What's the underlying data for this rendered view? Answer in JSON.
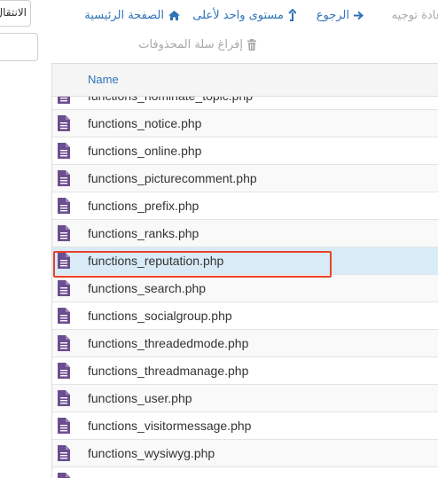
{
  "left_panel": {
    "button_label": "الانتقال",
    "input_value": ""
  },
  "toolbar": {
    "redirect_label": "إعادة توجيه",
    "back_label": "الرجوع",
    "up_label": "مستوى واحد لأعلى",
    "home_label": "الصفحة الرئيسية",
    "empty_trash_label": "إفراغ سلة المحذوفات"
  },
  "table": {
    "header": "Name",
    "rows": [
      "functions_nominate_topic.php",
      "functions_notice.php",
      "functions_online.php",
      "functions_picturecomment.php",
      "functions_prefix.php",
      "functions_ranks.php",
      "functions_reputation.php",
      "functions_search.php",
      "functions_socialgroup.php",
      "functions_threadedmode.php",
      "functions_threadmanage.php",
      "functions_user.php",
      "functions_visitormessage.php",
      "functions_wysiwyg.php",
      ""
    ],
    "selected_row": "functions_reputation.php"
  },
  "colors": {
    "link": "#2f73b9",
    "file_icon": "#6b4e8f",
    "selected_row": "#d9ebf7",
    "highlight_border": "#e8432b"
  },
  "icons": {
    "file": "file-text-icon",
    "home": "home-icon",
    "up": "level-up-icon",
    "back": "arrow-right-icon",
    "redirect": "arrow-right-icon",
    "trash": "trash-icon"
  }
}
